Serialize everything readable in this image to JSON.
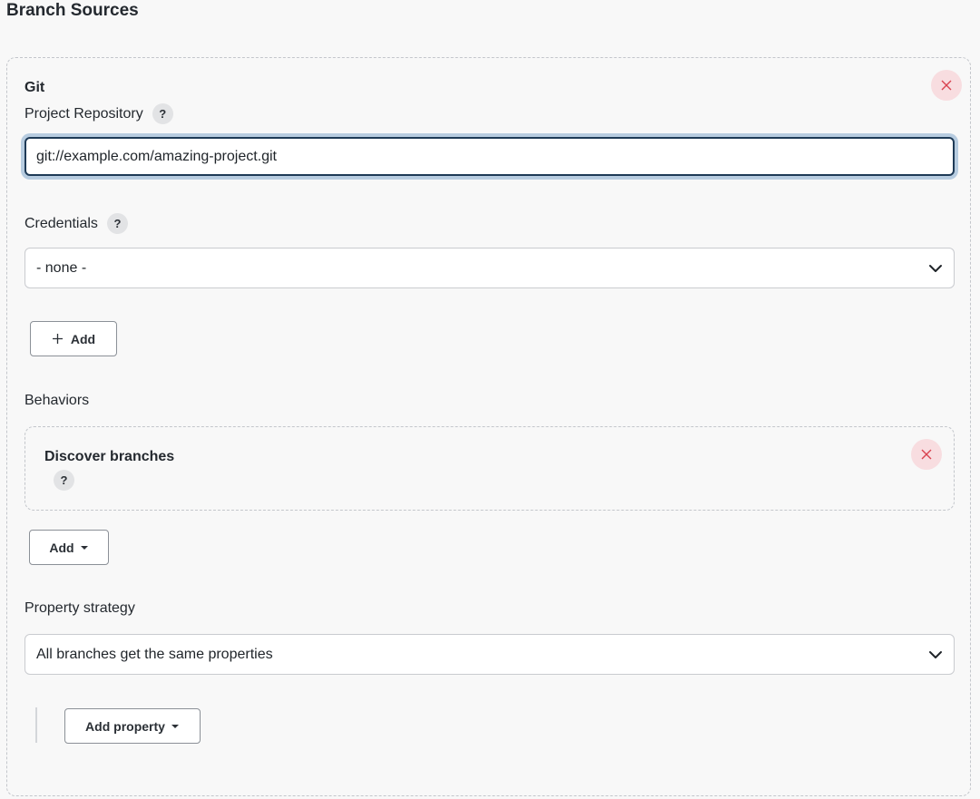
{
  "section_title": "Branch Sources",
  "git": {
    "heading": "Git",
    "repo_label": "Project Repository",
    "repo_value": "git://example.com/amazing-project.git",
    "credentials_label": "Credentials",
    "credentials_selected": "- none -",
    "add_credentials_label": "Add",
    "behaviors_label": "Behaviors",
    "behavior_item": {
      "title": "Discover branches"
    },
    "add_behavior_label": "Add",
    "property_strategy_label": "Property strategy",
    "property_strategy_selected": "All branches get the same properties",
    "add_property_label": "Add property"
  },
  "help_glyph": "?",
  "icons": {
    "close": "close-icon",
    "chevron": "chevron-down-icon",
    "plus": "plus-icon",
    "caret": "caret-down-icon"
  },
  "colors": {
    "focus_border": "#1e3a56",
    "focus_ring": "#b7cce0",
    "close_bg": "#f8dde0",
    "close_x": "#d9434f"
  }
}
